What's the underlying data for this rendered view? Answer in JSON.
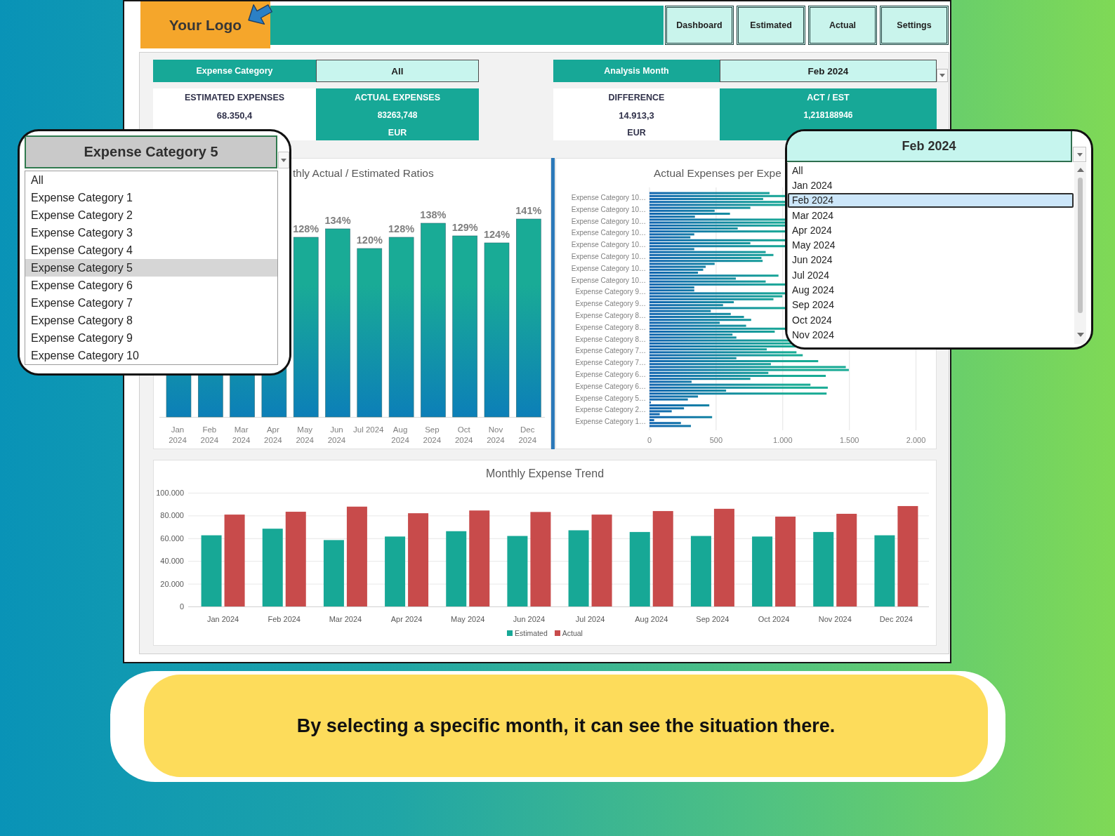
{
  "header": {
    "logo": "Your Logo",
    "nav_buttons": [
      "Dashboard",
      "Estimated",
      "Actual",
      "Settings"
    ]
  },
  "selector_groups": [
    {
      "label": "Expense Category",
      "value": "All",
      "dropdown": false,
      "kpis": [
        {
          "kind": "plain",
          "title": "ESTIMATED EXPENSES",
          "value": "68.350,4"
        },
        {
          "kind": "filled",
          "title": "ACTUAL EXPENSES",
          "value": "83263,748",
          "unit": "EUR"
        }
      ]
    },
    {
      "label": "Analysis Month",
      "value": "Feb 2024",
      "dropdown": true,
      "kpis": [
        {
          "kind": "plain",
          "title": "DIFFERENCE",
          "value": "14.913,3",
          "unit": "EUR"
        },
        {
          "kind": "filled",
          "title": "ACT / EST",
          "value": "1,218188946"
        }
      ]
    }
  ],
  "ratio_chart": {
    "chart_data": {
      "type": "bar",
      "title": "thly Actual / Estimated Ratios",
      "categories": [
        "Jan 2024",
        "Feb 2024",
        "Mar 2024",
        "Apr 2024",
        "May 2024",
        "Jun 2024",
        "Jul 2024",
        "Aug 2024",
        "Sep 2024",
        "Oct 2024",
        "Nov 2024",
        "Dec 2024"
      ],
      "values": [
        null,
        null,
        null,
        null,
        1.28,
        1.34,
        1.2,
        1.28,
        1.38,
        1.29,
        1.24,
        1.41
      ],
      "value_labels": [
        null,
        null,
        null,
        null,
        "128%",
        "134%",
        "120%",
        "128%",
        "138%",
        "129%",
        "124%",
        "141%"
      ]
    }
  },
  "expense_chart": {
    "chart_data": {
      "type": "bar",
      "orientation": "horizontal",
      "title": "Actual Expenses per Expe",
      "categories": [
        "Expense Category 10…",
        "Expense Category 10…",
        "Expense Category 10…",
        "Expense Category 10…",
        "Expense Category 10…",
        "Expense Category 10…",
        "Expense Category 10…",
        "Expense Category 10…",
        "Expense Category 9…",
        "Expense Category 9…",
        "Expense Category 8…",
        "Expense Category 8…",
        "Expense Category 8…",
        "Expense Category 7…",
        "Expense Category 7…",
        "Expense Category 6…",
        "Expense Category 6…",
        "Expense Category 5…",
        "Expense Category 2…",
        "Expense Category 1…"
      ],
      "series": [
        {
          "values": [
            901,
            null,
            341,
            662,
            null,
            872,
            489,
            968,
            336,
            930,
            460,
            527,
            623,
            null,
            652,
            1496,
            316,
            1329,
            449,
            470
          ]
        },
        {
          "values": [
            null,
            757,
            null,
            null,
            757,
            930,
            422,
            648,
            336,
            633,
            610,
            725,
            652,
            880,
            1266,
            892,
            1208,
            364,
            259,
            35
          ]
        },
        {
          "values": [
            853,
            489,
            null,
            336,
            null,
            840,
            403,
            872,
            null,
            552,
            709,
            null,
            null,
            1103,
            911,
            1323,
            1338,
            288,
            167,
            236
          ]
        },
        {
          "values": [
            null,
            604,
            null,
            307,
            336,
            849,
            364,
            null,
            997,
            null,
            763,
            940,
            null,
            1150,
            1473,
            757,
            575,
            10,
            77,
            311
          ]
        }
      ],
      "xlim": [
        0,
        2000
      ],
      "xticks": [
        0,
        500,
        {
          "value": 1000,
          "label": "1.000"
        },
        {
          "value": 1500,
          "label": "1.500"
        },
        {
          "value": 2000,
          "label": "2.000"
        }
      ],
      "grid": true
    }
  },
  "trend_chart": {
    "chart_data": {
      "type": "bar",
      "title": "Monthly Expense Trend",
      "categories": [
        "Jan 2024",
        "Feb 2024",
        "Mar 2024",
        "Apr 2024",
        "May 2024",
        "Jun 2024",
        "Jul 2024",
        "Aug 2024",
        "Sep 2024",
        "Oct 2024",
        "Nov 2024",
        "Dec 2024"
      ],
      "series": [
        {
          "name": "Estimated",
          "color": "#17a896",
          "values": [
            62600,
            68400,
            58400,
            61500,
            66200,
            62000,
            67000,
            65500,
            62000,
            61500,
            65500,
            62600
          ]
        },
        {
          "name": "Actual",
          "color": "#c84b4b",
          "values": [
            80800,
            83300,
            87800,
            82000,
            84400,
            83100,
            80800,
            83900,
            85900,
            79000,
            81500,
            88300
          ]
        }
      ],
      "ylim": [
        0,
        100000
      ],
      "yticks": [
        0,
        {
          "value": 20000,
          "label": "20.000"
        },
        {
          "value": 40000,
          "label": "40.000"
        },
        {
          "value": 60000,
          "label": "60.000"
        },
        {
          "value": 80000,
          "label": "80.000"
        },
        {
          "value": 100000,
          "label": "100.000"
        }
      ],
      "grid": true,
      "legend": "bottom"
    }
  },
  "category_dropdown": {
    "value": "Expense Category 5",
    "options": [
      {
        "label": "All",
        "selected": false
      },
      {
        "label": "Expense Category 1",
        "selected": false
      },
      {
        "label": "Expense Category 2",
        "selected": false
      },
      {
        "label": "Expense Category 3",
        "selected": false
      },
      {
        "label": "Expense Category 4",
        "selected": false
      },
      {
        "label": "Expense Category 5",
        "selected": true
      },
      {
        "label": "Expense Category 6",
        "selected": false
      },
      {
        "label": "Expense Category 7",
        "selected": false
      },
      {
        "label": "Expense Category 8",
        "selected": false
      },
      {
        "label": "Expense Category 9",
        "selected": false
      },
      {
        "label": "Expense Category 10",
        "selected": false
      }
    ]
  },
  "month_dropdown": {
    "value": "Feb 2024",
    "options": [
      {
        "label": "All",
        "selected": false
      },
      {
        "label": "Jan 2024",
        "selected": false
      },
      {
        "label": "Feb 2024",
        "selected": true
      },
      {
        "label": "Mar 2024",
        "selected": false
      },
      {
        "label": "Apr 2024",
        "selected": false
      },
      {
        "label": "May 2024",
        "selected": false
      },
      {
        "label": "Jun 2024",
        "selected": false
      },
      {
        "label": "Jul 2024",
        "selected": false
      },
      {
        "label": "Aug 2024",
        "selected": false
      },
      {
        "label": "Sep 2024",
        "selected": false
      },
      {
        "label": "Oct 2024",
        "selected": false
      },
      {
        "label": "Nov 2024",
        "selected": false
      }
    ]
  },
  "caption": "By selecting a specific month, it can see the situation there."
}
